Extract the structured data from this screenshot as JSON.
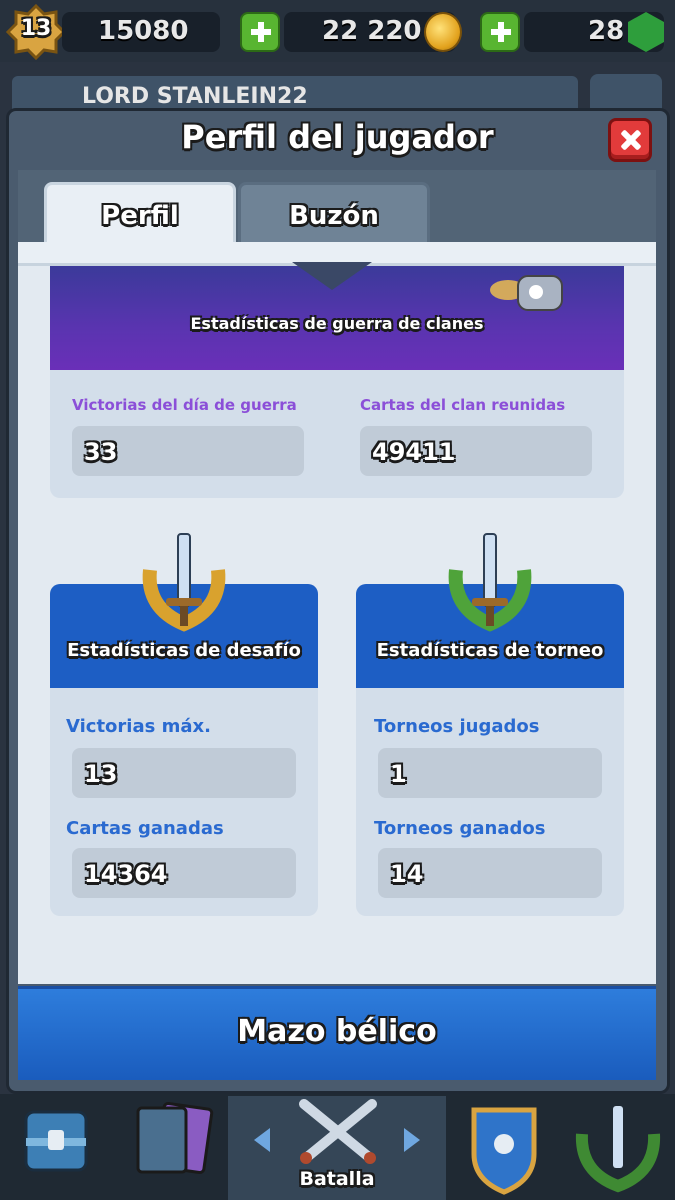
{
  "top_bar": {
    "level": "13",
    "trophies_value": "15080",
    "gold_value": "22 220",
    "gems_value": "28"
  },
  "name_bar": {
    "player_name": "LORD STANLEIN22"
  },
  "modal": {
    "title": "Perfil del jugador",
    "tabs": [
      {
        "label": "Perfil"
      },
      {
        "label": "Buzón"
      }
    ]
  },
  "clan_war": {
    "title": "Estadísticas de guerra de clanes",
    "war_day_wins_label": "Victorias del día de guerra",
    "war_day_wins_value": "33",
    "clan_cards_label": "Cartas del clan reunidas",
    "clan_cards_value": "49411"
  },
  "challenge": {
    "title": "Estadísticas de desafío",
    "max_wins_label": "Victorias máx.",
    "max_wins_value": "13",
    "cards_won_label": "Cartas ganadas",
    "cards_won_value": "14364"
  },
  "tournament": {
    "title": "Estadísticas de torneo",
    "played_label": "Torneos jugados",
    "played_value": "1",
    "won_label": "Torneos ganados",
    "won_value": "14"
  },
  "war_deck": {
    "label": "Mazo bélico"
  },
  "bottom_nav": {
    "active_label": "Batalla"
  },
  "colors": {
    "accent_blue": "#1d5ec4",
    "purple": "#8b4fd8",
    "green_plus": "#58b531",
    "close_red": "#e23b3b"
  }
}
